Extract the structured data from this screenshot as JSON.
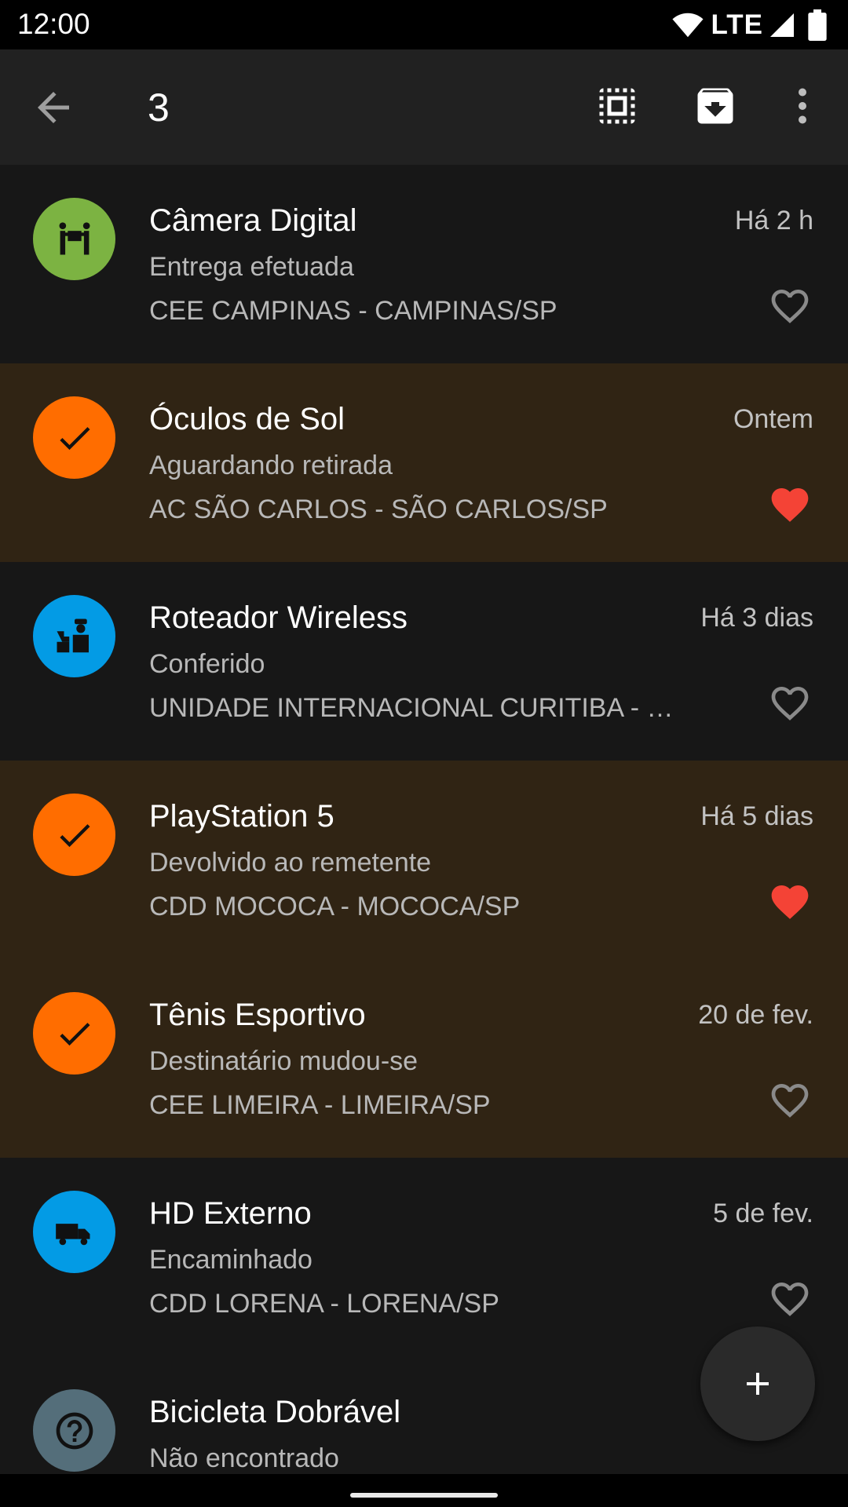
{
  "status_bar": {
    "time": "12:00",
    "network": "LTE"
  },
  "toolbar": {
    "selected_count": "3",
    "icons": [
      "back-arrow-icon",
      "select-all-icon",
      "archive-icon",
      "more-vert-icon"
    ]
  },
  "colors": {
    "green_avatar": "#7cb342",
    "orange_avatar": "#ff6d00",
    "blue_avatar": "#039be5",
    "gray_avatar": "#546e7a",
    "heart_filled": "#f44336",
    "selected_row": "#302414"
  },
  "items": [
    {
      "title": "Câmera Digital",
      "status": "Entrega efetuada",
      "location": "CEE CAMPINAS - CAMPINAS/SP",
      "time": "Há 2 h",
      "icon": "delivered-icon",
      "selected": false,
      "favorite": false
    },
    {
      "title": "Óculos de Sol",
      "status": "Aguardando retirada",
      "location": "AC SÃO CARLOS - SÃO CARLOS/SP",
      "time": "Ontem",
      "icon": "check-icon",
      "selected": true,
      "favorite": true
    },
    {
      "title": "Roteador Wireless",
      "status": "Conferido",
      "location": "UNIDADE INTERNACIONAL CURITIBA - …",
      "time": "Há 3 dias",
      "icon": "customs-officer-icon",
      "selected": false,
      "favorite": false
    },
    {
      "title": "PlayStation 5",
      "status": "Devolvido ao remetente",
      "location": "CDD MOCOCA - MOCOCA/SP",
      "time": "Há 5 dias",
      "icon": "check-icon",
      "selected": true,
      "favorite": true
    },
    {
      "title": "Tênis Esportivo",
      "status": "Destinatário mudou-se",
      "location": "CEE LIMEIRA - LIMEIRA/SP",
      "time": "20 de fev.",
      "icon": "check-icon",
      "selected": true,
      "favorite": false
    },
    {
      "title": "HD Externo",
      "status": "Encaminhado",
      "location": "CDD LORENA - LORENA/SP",
      "time": "5 de fev.",
      "icon": "truck-icon",
      "selected": false,
      "favorite": false
    },
    {
      "title": "Bicicleta Dobrável",
      "status": "Não encontrado",
      "location": "",
      "time": "",
      "icon": "help-icon",
      "selected": false,
      "favorite": false
    }
  ],
  "fab": {
    "icon": "add-icon"
  }
}
